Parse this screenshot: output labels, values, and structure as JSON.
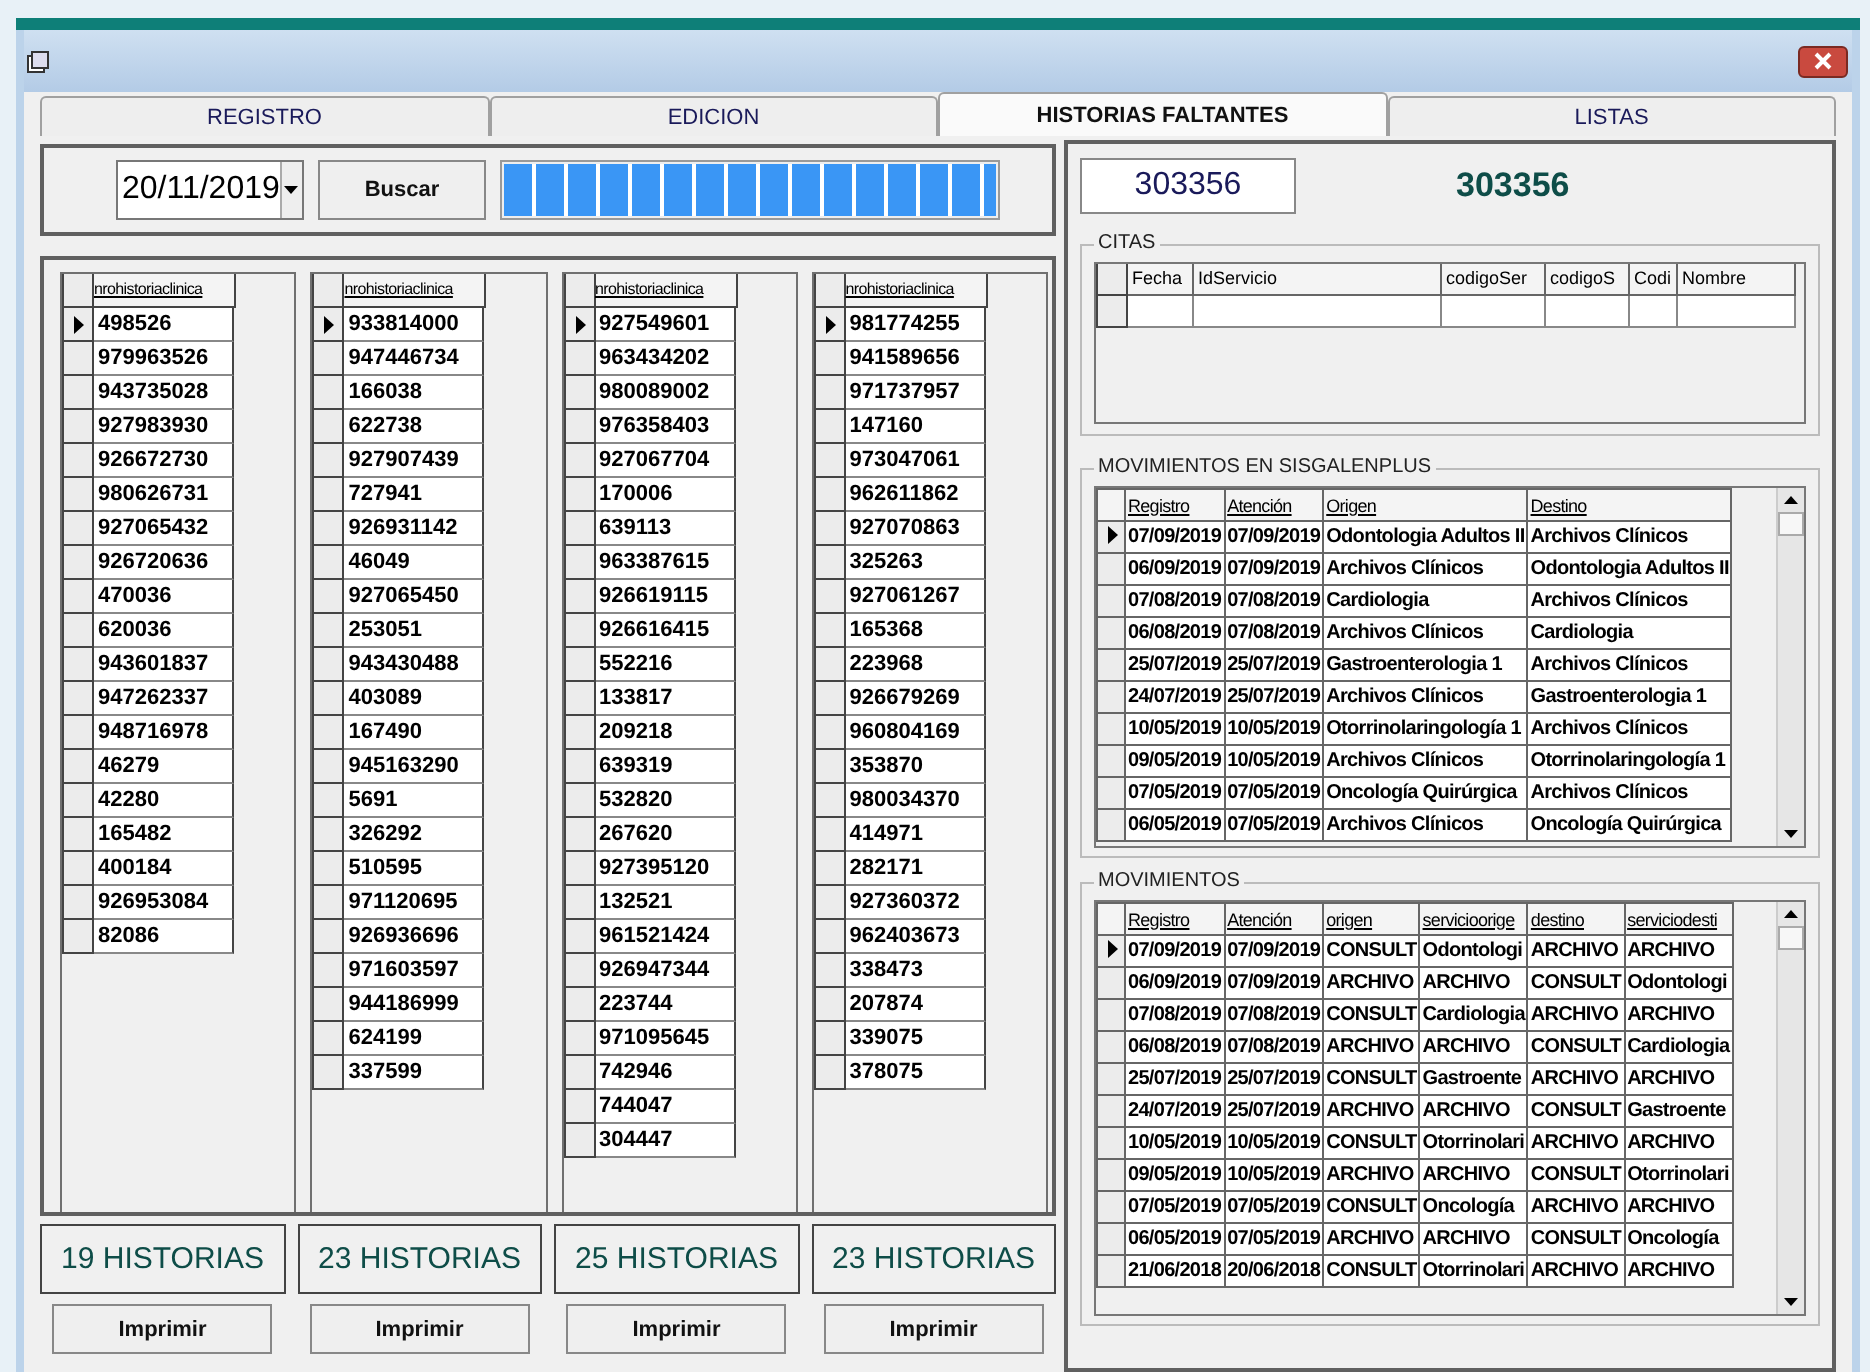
{
  "tabs": [
    {
      "label": "REGISTRO",
      "selected": false
    },
    {
      "label": "EDICION",
      "selected": false
    },
    {
      "label": "HISTORIAS FALTANTES",
      "selected": true
    },
    {
      "label": "LISTAS",
      "selected": false
    }
  ],
  "search": {
    "date": "20/11/2019",
    "button": "Buscar",
    "progress": {
      "level": 1
    }
  },
  "lists": [
    {
      "column": "nrohistoriaclinica",
      "count": "19 HISTORIAS",
      "print": "Imprimir",
      "rows": [
        {
          "value": "498526",
          "selected": true
        },
        {
          "value": "979963526",
          "selected": false
        },
        {
          "value": "943735028",
          "selected": false
        },
        {
          "value": "927983930",
          "selected": false
        },
        {
          "value": "926672730",
          "selected": false
        },
        {
          "value": "980626731",
          "selected": false
        },
        {
          "value": "927065432",
          "selected": false
        },
        {
          "value": "926720636",
          "selected": false
        },
        {
          "value": "470036",
          "selected": false
        },
        {
          "value": "620036",
          "selected": false
        },
        {
          "value": "943601837",
          "selected": false
        },
        {
          "value": "947262337",
          "selected": false
        },
        {
          "value": "948716978",
          "selected": false
        },
        {
          "value": "46279",
          "selected": false
        },
        {
          "value": "42280",
          "selected": false
        },
        {
          "value": "165482",
          "selected": false
        },
        {
          "value": "400184",
          "selected": false
        },
        {
          "value": "926953084",
          "selected": false
        },
        {
          "value": "82086",
          "selected": false
        }
      ]
    },
    {
      "column": "nrohistoriaclinica",
      "count": "23 HISTORIAS",
      "print": "Imprimir",
      "rows": [
        {
          "value": "933814000",
          "selected": true
        },
        {
          "value": "947446734",
          "selected": false
        },
        {
          "value": "166038",
          "selected": false
        },
        {
          "value": "622738",
          "selected": false
        },
        {
          "value": "927907439",
          "selected": false
        },
        {
          "value": "727941",
          "selected": false
        },
        {
          "value": "926931142",
          "selected": false
        },
        {
          "value": "46049",
          "selected": false
        },
        {
          "value": "927065450",
          "selected": false
        },
        {
          "value": "253051",
          "selected": false
        },
        {
          "value": "943430488",
          "selected": false
        },
        {
          "value": "403089",
          "selected": false
        },
        {
          "value": "167490",
          "selected": false
        },
        {
          "value": "945163290",
          "selected": false
        },
        {
          "value": "5691",
          "selected": false
        },
        {
          "value": "326292",
          "selected": false
        },
        {
          "value": "510595",
          "selected": false
        },
        {
          "value": "971120695",
          "selected": false
        },
        {
          "value": "926936696",
          "selected": false
        },
        {
          "value": "971603597",
          "selected": false
        },
        {
          "value": "944186999",
          "selected": false
        },
        {
          "value": "624199",
          "selected": false
        },
        {
          "value": "337599",
          "selected": false
        }
      ]
    },
    {
      "column": "nrohistoriaclinica",
      "count": "25 HISTORIAS",
      "print": "Imprimir",
      "rows": [
        {
          "value": "927549601",
          "selected": true
        },
        {
          "value": "963434202",
          "selected": false
        },
        {
          "value": "980089002",
          "selected": false
        },
        {
          "value": "976358403",
          "selected": false
        },
        {
          "value": "927067704",
          "selected": false
        },
        {
          "value": "170006",
          "selected": false
        },
        {
          "value": "639113",
          "selected": false
        },
        {
          "value": "963387615",
          "selected": false
        },
        {
          "value": "926619115",
          "selected": false
        },
        {
          "value": "926616415",
          "selected": false
        },
        {
          "value": "552216",
          "selected": false
        },
        {
          "value": "133817",
          "selected": false
        },
        {
          "value": "209218",
          "selected": false
        },
        {
          "value": "639319",
          "selected": false
        },
        {
          "value": "532820",
          "selected": false
        },
        {
          "value": "267620",
          "selected": false
        },
        {
          "value": "927395120",
          "selected": false
        },
        {
          "value": "132521",
          "selected": false
        },
        {
          "value": "961521424",
          "selected": false
        },
        {
          "value": "926947344",
          "selected": false
        },
        {
          "value": "223744",
          "selected": false
        },
        {
          "value": "971095645",
          "selected": false
        },
        {
          "value": "742946",
          "selected": false
        },
        {
          "value": "744047",
          "selected": false
        },
        {
          "value": "304447",
          "selected": false
        }
      ]
    },
    {
      "column": "nrohistoriaclinica",
      "count": "23 HISTORIAS",
      "print": "Imprimir",
      "rows": [
        {
          "value": "981774255",
          "selected": true
        },
        {
          "value": "941589656",
          "selected": false
        },
        {
          "value": "971737957",
          "selected": false
        },
        {
          "value": "147160",
          "selected": false
        },
        {
          "value": "973047061",
          "selected": false
        },
        {
          "value": "962611862",
          "selected": false
        },
        {
          "value": "927070863",
          "selected": false
        },
        {
          "value": "325263",
          "selected": false
        },
        {
          "value": "927061267",
          "selected": false
        },
        {
          "value": "165368",
          "selected": false
        },
        {
          "value": "223968",
          "selected": false
        },
        {
          "value": "926679269",
          "selected": false
        },
        {
          "value": "960804169",
          "selected": false
        },
        {
          "value": "353870",
          "selected": false
        },
        {
          "value": "980034370",
          "selected": false
        },
        {
          "value": "414971",
          "selected": false
        },
        {
          "value": "282171",
          "selected": false
        },
        {
          "value": "927360372",
          "selected": false
        },
        {
          "value": "962403673",
          "selected": false
        },
        {
          "value": "338473",
          "selected": false
        },
        {
          "value": "207874",
          "selected": false
        },
        {
          "value": "339075",
          "selected": false
        },
        {
          "value": "378075",
          "selected": false
        }
      ]
    }
  ],
  "history": {
    "value": "303356",
    "label": "303356"
  },
  "citas": {
    "title": "CITAS",
    "columns": [
      "Fecha",
      "IdServicio",
      "codigoSer",
      "codigoS",
      "Codi",
      "Nombre"
    ]
  },
  "movimientos_sisgalenplus": {
    "title": "MOVIMIENTOS EN SISGALENPLUS",
    "columns": [
      "Registro",
      "Atención",
      "Origen",
      "Destino"
    ],
    "rows": [
      {
        "selected": true,
        "cells": [
          "07/09/2019",
          "07/09/2019",
          "Odontologia Adultos II",
          "Archivos Clínicos"
        ]
      },
      {
        "selected": false,
        "cells": [
          "06/09/2019",
          "07/09/2019",
          "Archivos Clínicos",
          "Odontologia Adultos II"
        ]
      },
      {
        "selected": false,
        "cells": [
          "07/08/2019",
          "07/08/2019",
          "Cardiologia",
          "Archivos Clínicos"
        ]
      },
      {
        "selected": false,
        "cells": [
          "06/08/2019",
          "07/08/2019",
          "Archivos Clínicos",
          "Cardiologia"
        ]
      },
      {
        "selected": false,
        "cells": [
          "25/07/2019",
          "25/07/2019",
          "Gastroenterologia 1",
          "Archivos Clínicos"
        ]
      },
      {
        "selected": false,
        "cells": [
          "24/07/2019",
          "25/07/2019",
          "Archivos Clínicos",
          "Gastroenterologia 1"
        ]
      },
      {
        "selected": false,
        "cells": [
          "10/05/2019",
          "10/05/2019",
          "Otorrinolaringología 1",
          "Archivos Clínicos"
        ]
      },
      {
        "selected": false,
        "cells": [
          "09/05/2019",
          "10/05/2019",
          "Archivos Clínicos",
          "Otorrinolaringología 1"
        ]
      },
      {
        "selected": false,
        "cells": [
          "07/05/2019",
          "07/05/2019",
          "Oncología Quirúrgica",
          "Archivos Clínicos"
        ]
      },
      {
        "selected": false,
        "cells": [
          "06/05/2019",
          "07/05/2019",
          "Archivos Clínicos",
          "Oncología Quirúrgica"
        ]
      }
    ]
  },
  "movimientos": {
    "title": "MOVIMIENTOS",
    "columns": [
      "Registro",
      "Atención",
      "origen",
      "servicioorige",
      "destino",
      "serviciodesti"
    ],
    "rows": [
      {
        "selected": true,
        "cells": [
          "07/09/2019",
          "07/09/2019",
          "CONSULT",
          "Odontologi",
          "ARCHIVO",
          "ARCHIVO"
        ]
      },
      {
        "selected": false,
        "cells": [
          "06/09/2019",
          "07/09/2019",
          "ARCHIVO",
          "ARCHIVO",
          "CONSULT",
          "Odontologi"
        ]
      },
      {
        "selected": false,
        "cells": [
          "07/08/2019",
          "07/08/2019",
          "CONSULT",
          "Cardiologia",
          "ARCHIVO",
          "ARCHIVO"
        ]
      },
      {
        "selected": false,
        "cells": [
          "06/08/2019",
          "07/08/2019",
          "ARCHIVO",
          "ARCHIVO",
          "CONSULT",
          "Cardiologia"
        ]
      },
      {
        "selected": false,
        "cells": [
          "25/07/2019",
          "25/07/2019",
          "CONSULT",
          "Gastroente",
          "ARCHIVO",
          "ARCHIVO"
        ]
      },
      {
        "selected": false,
        "cells": [
          "24/07/2019",
          "25/07/2019",
          "ARCHIVO",
          "ARCHIVO",
          "CONSULT",
          "Gastroente"
        ]
      },
      {
        "selected": false,
        "cells": [
          "10/05/2019",
          "10/05/2019",
          "CONSULT",
          "Otorrinolari",
          "ARCHIVO",
          "ARCHIVO"
        ]
      },
      {
        "selected": false,
        "cells": [
          "09/05/2019",
          "10/05/2019",
          "ARCHIVO",
          "ARCHIVO",
          "CONSULT",
          "Otorrinolari"
        ]
      },
      {
        "selected": false,
        "cells": [
          "07/05/2019",
          "07/05/2019",
          "CONSULT",
          "Oncología",
          "ARCHIVO",
          "ARCHIVO"
        ]
      },
      {
        "selected": false,
        "cells": [
          "06/05/2019",
          "07/05/2019",
          "ARCHIVO",
          "ARCHIVO",
          "CONSULT",
          "Oncología"
        ]
      },
      {
        "selected": false,
        "cells": [
          "21/06/2018",
          "20/06/2018",
          "CONSULT",
          "Otorrinolari",
          "ARCHIVO",
          "ARCHIVO"
        ]
      }
    ]
  }
}
